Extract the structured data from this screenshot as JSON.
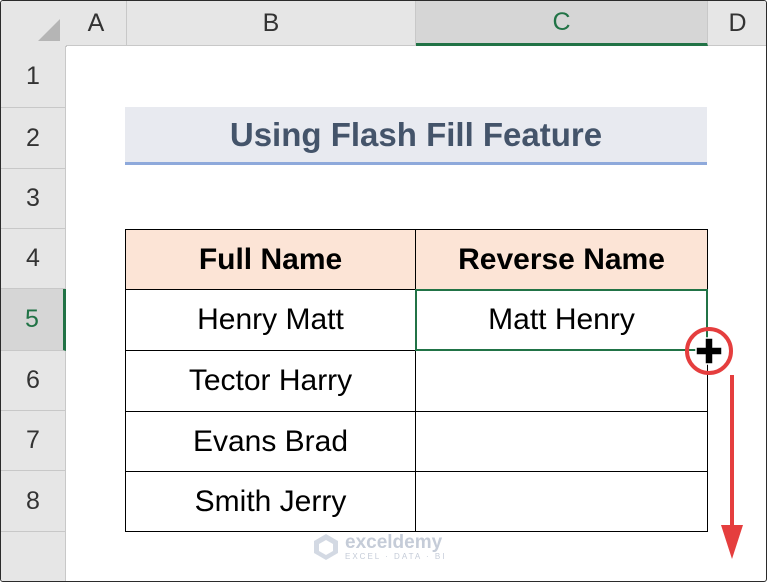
{
  "columns": [
    {
      "label": "A",
      "selected": false
    },
    {
      "label": "B",
      "selected": false
    },
    {
      "label": "C",
      "selected": true
    },
    {
      "label": "D",
      "selected": false
    }
  ],
  "rows": [
    {
      "label": "1",
      "selected": false
    },
    {
      "label": "2",
      "selected": false
    },
    {
      "label": "3",
      "selected": false
    },
    {
      "label": "4",
      "selected": false
    },
    {
      "label": "5",
      "selected": true
    },
    {
      "label": "6",
      "selected": false
    },
    {
      "label": "7",
      "selected": false
    },
    {
      "label": "8",
      "selected": false
    }
  ],
  "title": "Using Flash Fill Feature",
  "table": {
    "headers": [
      "Full Name",
      "Reverse Name"
    ],
    "rows": [
      [
        "Henry Matt",
        "Matt Henry"
      ],
      [
        "Tector Harry",
        ""
      ],
      [
        "Evans Brad",
        ""
      ],
      [
        "Smith Jerry",
        ""
      ]
    ]
  },
  "active_cell": "C5",
  "watermark": {
    "brand": "exceldemy",
    "tagline": "EXCEL · DATA · BI"
  },
  "colors": {
    "accent": "#217346",
    "header_fill": "#fce4d6",
    "annotation": "#e53e3e",
    "title_text": "#44546a"
  }
}
